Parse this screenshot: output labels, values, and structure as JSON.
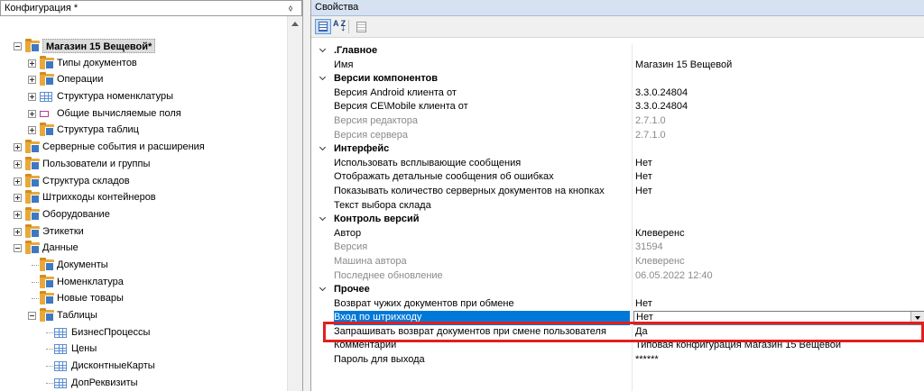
{
  "left_panel": {
    "title": "Конфигурация *",
    "pin_glyph": "⬨",
    "tree": [
      {
        "label": "Магазин 15 Вещевой*",
        "level": 0,
        "exp": "minus",
        "icon": "folder",
        "root": true
      },
      {
        "label": "Типы документов",
        "level": 1,
        "exp": "plus",
        "icon": "folder"
      },
      {
        "label": "Операции",
        "level": 1,
        "exp": "plus",
        "icon": "folder"
      },
      {
        "label": "Структура номенклатуры",
        "level": 1,
        "exp": "plus",
        "icon": "grid"
      },
      {
        "label": "Общие вычисляемые поля",
        "level": 1,
        "exp": "plus",
        "icon": "calc"
      },
      {
        "label": "Структура таблиц",
        "level": 1,
        "exp": "plus",
        "icon": "folder"
      },
      {
        "label": "Серверные события и расширения",
        "level": 0,
        "exp": "plus",
        "icon": "folder"
      },
      {
        "label": "Пользователи и группы",
        "level": 0,
        "exp": "plus",
        "icon": "folder"
      },
      {
        "label": "Структура складов",
        "level": 0,
        "exp": "plus",
        "icon": "folder"
      },
      {
        "label": "Штрихкоды контейнеров",
        "level": 0,
        "exp": "plus",
        "icon": "folder"
      },
      {
        "label": "Оборудование",
        "level": 0,
        "exp": "plus",
        "icon": "folder"
      },
      {
        "label": "Этикетки",
        "level": 0,
        "exp": "plus",
        "icon": "folder"
      },
      {
        "label": "Данные",
        "level": 0,
        "exp": "minus",
        "icon": "folder"
      },
      {
        "label": "Документы",
        "level": 1,
        "exp": "none",
        "icon": "folder"
      },
      {
        "label": "Номенклатура",
        "level": 1,
        "exp": "none",
        "icon": "folder"
      },
      {
        "label": "Новые товары",
        "level": 1,
        "exp": "none",
        "icon": "folder"
      },
      {
        "label": "Таблицы",
        "level": 1,
        "exp": "minus",
        "icon": "folder"
      },
      {
        "label": "БизнесПроцессы",
        "level": 2,
        "exp": "none",
        "icon": "grid"
      },
      {
        "label": "Цены",
        "level": 2,
        "exp": "none",
        "icon": "grid"
      },
      {
        "label": "ДисконтныеКарты",
        "level": 2,
        "exp": "none",
        "icon": "grid"
      },
      {
        "label": "ДопРеквизиты",
        "level": 2,
        "exp": "none",
        "icon": "grid"
      }
    ]
  },
  "right_panel": {
    "title": "Свойства",
    "toolbar": {
      "sort_az_label": "A Z",
      "sort_arrow": "↓"
    },
    "rows": [
      {
        "type": "cat",
        "key": ".Главное"
      },
      {
        "type": "prop",
        "key": "Имя",
        "value": "Магазин 15 Вещевой"
      },
      {
        "type": "cat",
        "key": "Версии компонентов"
      },
      {
        "type": "prop",
        "key": "Версия Android клиента от",
        "value": "3.3.0.24804"
      },
      {
        "type": "prop",
        "key": "Версия CE\\Mobile клиента от",
        "value": "3.3.0.24804"
      },
      {
        "type": "prop",
        "key": "Версия редактора",
        "value": "2.7.1.0",
        "ro": true
      },
      {
        "type": "prop",
        "key": "Версия сервера",
        "value": "2.7.1.0",
        "ro": true
      },
      {
        "type": "cat",
        "key": "Интерфейс"
      },
      {
        "type": "prop",
        "key": "Использовать всплывающие сообщения",
        "value": "Нет"
      },
      {
        "type": "prop",
        "key": "Отображать детальные сообщения об ошибках",
        "value": "Нет"
      },
      {
        "type": "prop",
        "key": "Показывать количество серверных документов на кнопках",
        "value": "Нет"
      },
      {
        "type": "prop",
        "key": "Текст выбора склада",
        "value": ""
      },
      {
        "type": "cat",
        "key": "Контроль версий"
      },
      {
        "type": "prop",
        "key": "Автор",
        "value": "Клеверенс"
      },
      {
        "type": "prop",
        "key": "Версия",
        "value": "31594",
        "ro": true
      },
      {
        "type": "prop",
        "key": "Машина автора",
        "value": "Клеверенс",
        "ro": true
      },
      {
        "type": "prop",
        "key": "Последнее обновление",
        "value": "06.05.2022 12:40",
        "ro": true
      },
      {
        "type": "cat",
        "key": "Прочее"
      },
      {
        "type": "prop",
        "key": "Возврат чужих документов при обмене",
        "value": "Нет"
      },
      {
        "type": "prop",
        "key": "Вход по штрихкоду",
        "value": "Нет",
        "selected": true
      },
      {
        "type": "prop",
        "key": "Запрашивать возврат документов при смене пользователя",
        "value": "Да"
      },
      {
        "type": "prop",
        "key": "Комментарий",
        "value": "Типовая конфигурация Магазин 15 Вещевой"
      },
      {
        "type": "prop",
        "key": "Пароль для выхода",
        "value": "******"
      }
    ]
  },
  "colors": {
    "selection": "#0078d7",
    "highlight": "#e02020",
    "header_bg": "#d6e2f2"
  }
}
